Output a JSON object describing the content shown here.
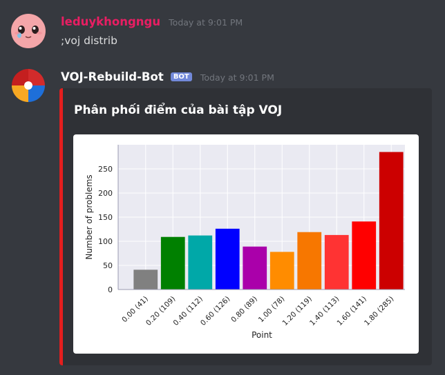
{
  "messages": [
    {
      "username": "leduykhongngu",
      "username_color": "#e91e63",
      "timestamp": "Today at 9:01 PM",
      "content": ";voj distrib"
    },
    {
      "username": "VOJ-Rebuild-Bot",
      "username_color": "#ffffff",
      "bot_tag": "BOT",
      "timestamp": "Today at 9:01 PM",
      "embed": {
        "title": "Phân phối điểm của bài tập VOJ",
        "accent_color": "#e41e1e"
      }
    }
  ],
  "chart_data": {
    "type": "bar",
    "xlabel": "Point",
    "ylabel": "Number of problems",
    "categories": [
      "0.00 (41)",
      "0.20 (109)",
      "0.40 (112)",
      "0.60 (126)",
      "0.80 (89)",
      "1.00 (78)",
      "1.20 (119)",
      "1.40 (113)",
      "1.60 (141)",
      "1.80 (285)"
    ],
    "values": [
      41,
      109,
      112,
      126,
      89,
      78,
      119,
      113,
      141,
      285
    ],
    "colors": [
      "#808080",
      "#008000",
      "#00a8a8",
      "#0000ff",
      "#aa00aa",
      "#ff8c00",
      "#f77700",
      "#ff3333",
      "#ff0000",
      "#cc0000"
    ],
    "ylim": [
      0,
      300
    ],
    "yticks": [
      0,
      50,
      100,
      150,
      200,
      250
    ],
    "grid": true
  }
}
